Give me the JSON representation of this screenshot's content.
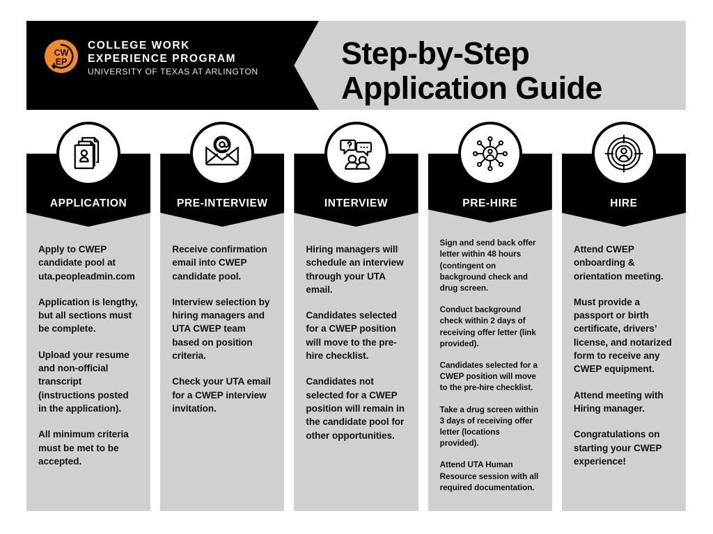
{
  "header": {
    "logo": {
      "mark_alt": "cwep-logo",
      "line1": "COLLEGE WORK",
      "line2": "EXPERIENCE PROGRAM",
      "line3": "UNIVERSITY OF TEXAS AT ARLINGTON"
    },
    "title_line1": "Step-by-Step",
    "title_line2": "Application Guide"
  },
  "colors": {
    "accent": "#ED8B33",
    "panel_dark": "#000000",
    "panel_light": "#D0D0D0",
    "page_background": "#FFFFFF",
    "text_dark": "#111111",
    "text_light": "#FFFFFF"
  },
  "steps": [
    {
      "label": "APPLICATION",
      "icon": "documents-person-icon",
      "paragraphs": [
        "Apply to CWEP candidate pool at uta.peopleadmin.com",
        "Application is lengthy, but all sections must be complete.",
        "Upload your resume and non-official transcript (instructions posted in the application).",
        "All minimum criteria must be met to be accepted."
      ]
    },
    {
      "label": "PRE-INTERVIEW",
      "icon": "envelope-at-icon",
      "paragraphs": [
        "Receive confirmation email into CWEP candidate pool.",
        "Interview selection by hiring managers and UTA CWEP team based on position criteria.",
        "Check your UTA email for a CWEP interview invitation."
      ]
    },
    {
      "label": "INTERVIEW",
      "icon": "speech-bubbles-people-icon",
      "paragraphs": [
        "Hiring managers will schedule an interview through your UTA email.",
        "Candidates selected for a CWEP position will move to the pre-hire checklist.",
        "Candidates not selected for a CWEP position will remain in the candidate pool for other opportunities."
      ]
    },
    {
      "label": "PRE-HIRE",
      "icon": "network-person-icon",
      "paragraphs": [
        "Sign and send back offer letter within 48 hours (contingent on background check and drug screen.",
        "Conduct background check within 2 days of receiving offer letter (link provided).",
        "Candidates selected for a CWEP position will move to the pre-hire checklist.",
        "Take a drug screen within 3 days of receiving offer letter (locations provided).",
        "Attend UTA Human Resource session with all required documentation."
      ]
    },
    {
      "label": "HIRE",
      "icon": "target-person-icon",
      "paragraphs": [
        "Attend CWEP onboarding & orientation meeting.",
        "Must provide a passport or birth certificate, drivers’ license, and notarized form to receive any CWEP equipment.",
        "Attend meeting with Hiring manager.",
        "Congratulations on starting your CWEP experience!"
      ]
    }
  ]
}
